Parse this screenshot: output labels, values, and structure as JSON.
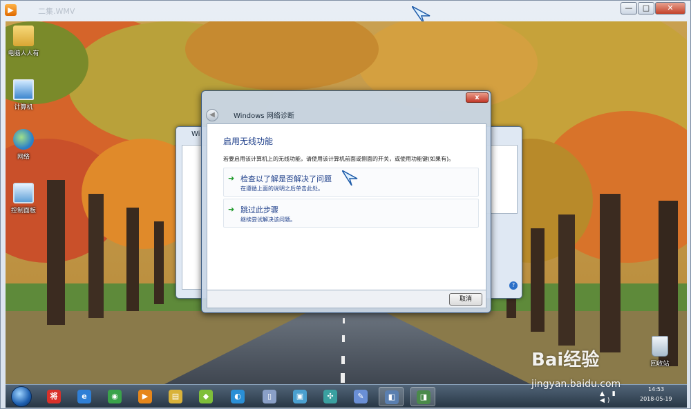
{
  "player": {
    "title": "二集.WMV",
    "controls": {
      "minimize": "—",
      "maximize": "□",
      "close": "✕"
    }
  },
  "desktop_icons": [
    {
      "label": "电脑人人有",
      "icon": "folder-icon"
    },
    {
      "label": "计算机",
      "icon": "computer-icon"
    },
    {
      "label": "网络",
      "icon": "network-icon"
    },
    {
      "label": "控制面板",
      "icon": "control-panel-icon"
    },
    {
      "label": "回收站",
      "icon": "recycle-bin-icon"
    }
  ],
  "dialog": {
    "close_label": "x",
    "back_label": "◀",
    "window_title": "Windows 网络诊断",
    "heading": "启用无线功能",
    "description": "若要启用该计算机上的无线功能，请使用该计算机前面或侧面的开关，或使用功能键(如果有)。",
    "options": [
      {
        "title": "检查以了解是否解决了问题",
        "subtitle": "在遵循上面的说明之后单击此处。"
      },
      {
        "title": "跳过此步骤",
        "subtitle": "继续尝试解决该问题。"
      }
    ],
    "cancel_label": "取消"
  },
  "background_window": {
    "title_fragment": "Wi"
  },
  "taskbar": {
    "pinned": [
      {
        "name": "sogou-icon",
        "glyph": "将",
        "color": "#d9302a"
      },
      {
        "name": "ie-icon",
        "glyph": "e",
        "color": "#2f7fd6"
      },
      {
        "name": "chrome-icon",
        "glyph": "◉",
        "color": "#3aa34a"
      },
      {
        "name": "media-player-icon",
        "glyph": "▶",
        "color": "#e6861a"
      },
      {
        "name": "explorer-icon",
        "glyph": "▤",
        "color": "#d9b23a"
      },
      {
        "name": "folder-icon",
        "glyph": "◆",
        "color": "#7fbf3a"
      },
      {
        "name": "qq-browser-icon",
        "glyph": "◐",
        "color": "#2a8fd6"
      },
      {
        "name": "document-icon",
        "glyph": "▯",
        "color": "#8aa0c8"
      },
      {
        "name": "remote-desktop-icon",
        "glyph": "▣",
        "color": "#4aa0d0"
      },
      {
        "name": "snipping-icon",
        "glyph": "✣",
        "color": "#3aa0a0"
      },
      {
        "name": "paint-icon",
        "glyph": "✎",
        "color": "#6a8fd6"
      },
      {
        "name": "network-diagnostics-icon",
        "glyph": "◧",
        "color": "#5a7fb0"
      },
      {
        "name": "network-settings-icon",
        "glyph": "◨",
        "color": "#4a8a4a"
      }
    ],
    "time": "14:53",
    "date": "2018-05-19",
    "tray": "▲ ▮ ◀)"
  },
  "watermark": {
    "text": "Bai经验",
    "url": "jingyan.baidu.com"
  }
}
